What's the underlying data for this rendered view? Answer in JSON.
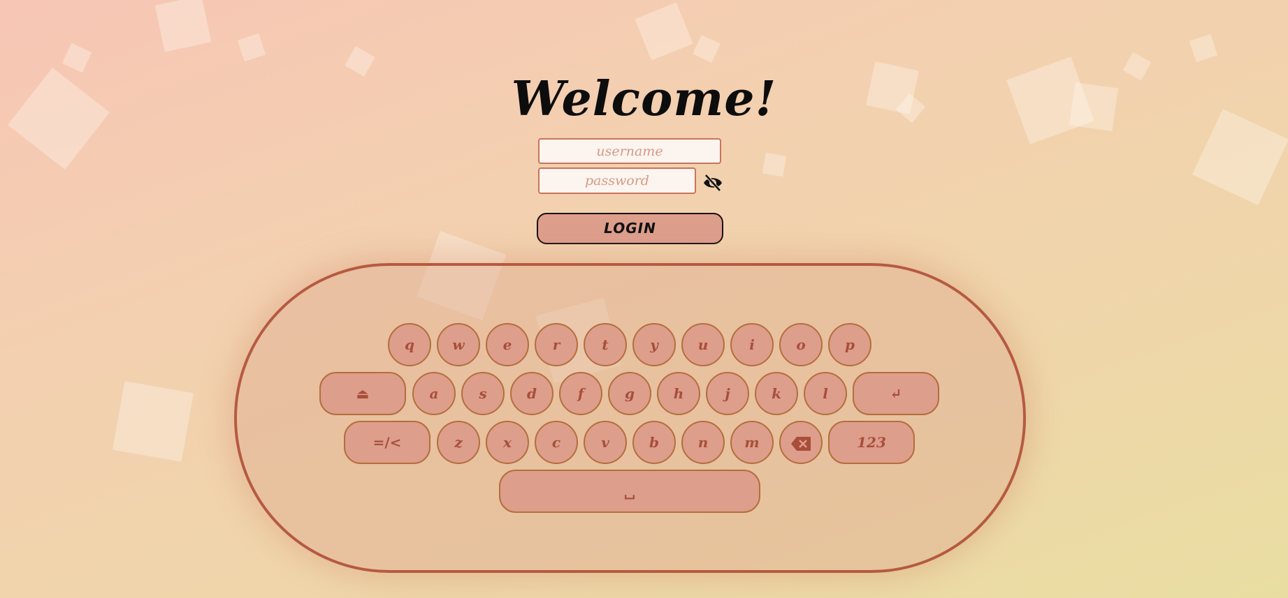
{
  "header": {
    "title": "Welcome!"
  },
  "form": {
    "username_placeholder": "username",
    "password_placeholder": "password",
    "toggle_visibility_icon": "eye-off-icon",
    "login_label": "LOGIN"
  },
  "keyboard": {
    "row1": [
      "q",
      "w",
      "e",
      "r",
      "t",
      "y",
      "u",
      "i",
      "o",
      "p"
    ],
    "row2": [
      "a",
      "s",
      "d",
      "f",
      "g",
      "h",
      "j",
      "k",
      "l"
    ],
    "row3": [
      "z",
      "x",
      "c",
      "v",
      "b",
      "n",
      "m"
    ],
    "shift_label": "⏏",
    "enter_label": "↵",
    "symbols_label": "=/<",
    "numbers_label": "123",
    "space_label": "␣",
    "backspace_icon": "backspace-icon"
  },
  "colors": {
    "accent": "#b55a40",
    "key_fill": "#dd9e8c",
    "key_text": "#a84e3a"
  }
}
